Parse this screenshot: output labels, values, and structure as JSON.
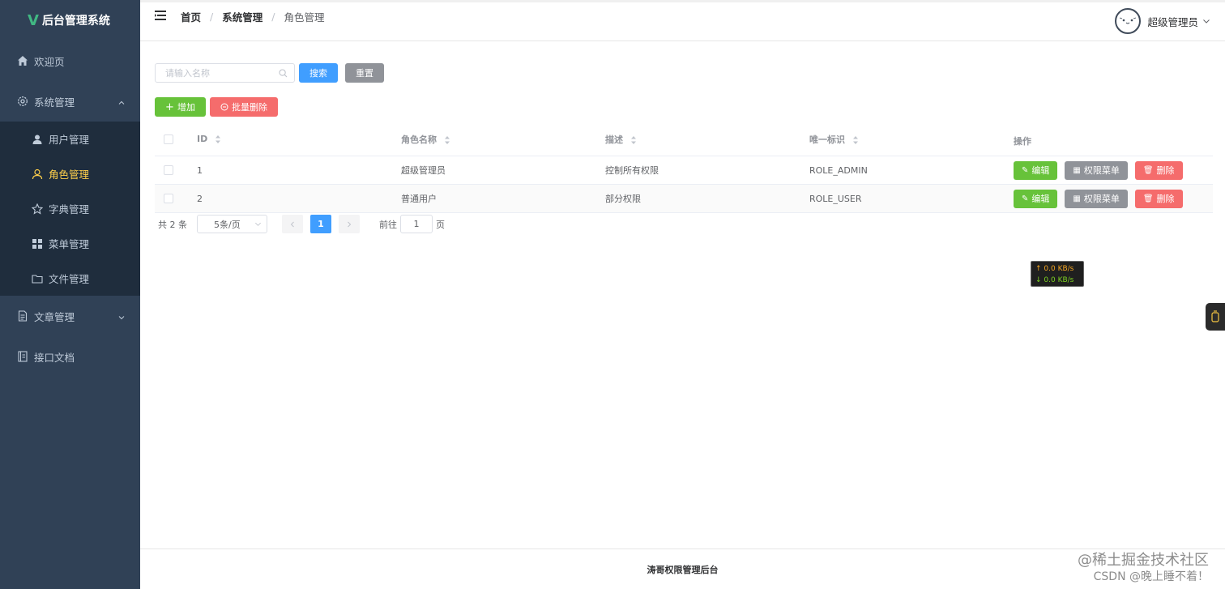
{
  "app": {
    "title": "后台管理系统",
    "logo_letter": "V"
  },
  "sidebar": {
    "items": [
      {
        "label": "欢迎页",
        "icon": "home-icon"
      },
      {
        "label": "系统管理",
        "icon": "gear-icon",
        "expanded": true,
        "children": [
          {
            "label": "用户管理",
            "icon": "user-icon"
          },
          {
            "label": "角色管理",
            "icon": "user-outline-icon",
            "active": true
          },
          {
            "label": "字典管理",
            "icon": "star-icon"
          },
          {
            "label": "菜单管理",
            "icon": "grid-icon"
          },
          {
            "label": "文件管理",
            "icon": "folder-icon"
          }
        ]
      },
      {
        "label": "文章管理",
        "icon": "document-icon",
        "expanded": false
      },
      {
        "label": "接口文档",
        "icon": "notebook-icon"
      }
    ]
  },
  "header": {
    "breadcrumb": [
      "首页",
      "系统管理",
      "角色管理"
    ],
    "breadcrumb_sep": "/",
    "user_name": "超级管理员"
  },
  "search": {
    "placeholder": "请输入名称",
    "search_label": "搜索",
    "reset_label": "重置"
  },
  "actions": {
    "add_label": "增加",
    "batch_delete_label": "批量删除"
  },
  "table": {
    "columns": [
      "ID",
      "角色名称",
      "描述",
      "唯一标识",
      "操作"
    ],
    "rows": [
      {
        "id": "1",
        "name": "超级管理员",
        "desc": "控制所有权限",
        "key": "ROLE_ADMIN"
      },
      {
        "id": "2",
        "name": "普通用户",
        "desc": "部分权限",
        "key": "ROLE_USER"
      }
    ],
    "row_actions": {
      "edit": "编辑",
      "menu": "权限菜单",
      "delete": "删除"
    }
  },
  "pagination": {
    "total_text": "共 2 条",
    "page_size": "5条/页",
    "current_page": "1",
    "goto_label": "前往",
    "goto_value": "1",
    "page_suffix": "页"
  },
  "footer": {
    "text": "涛哥权限管理后台"
  },
  "net_speed": {
    "up": "↑ 0.0 KB/s",
    "down": "↓ 0.0 KB/s"
  },
  "watermark": {
    "line1": "@稀土掘金技术社区",
    "line2": "CSDN @晚上睡不着！"
  },
  "colors": {
    "sidebar_bg": "#304156",
    "sidebar_active": "#ffd04b",
    "primary": "#409eff",
    "success": "#67c23a",
    "danger": "#f56c6c",
    "info": "#909399"
  }
}
